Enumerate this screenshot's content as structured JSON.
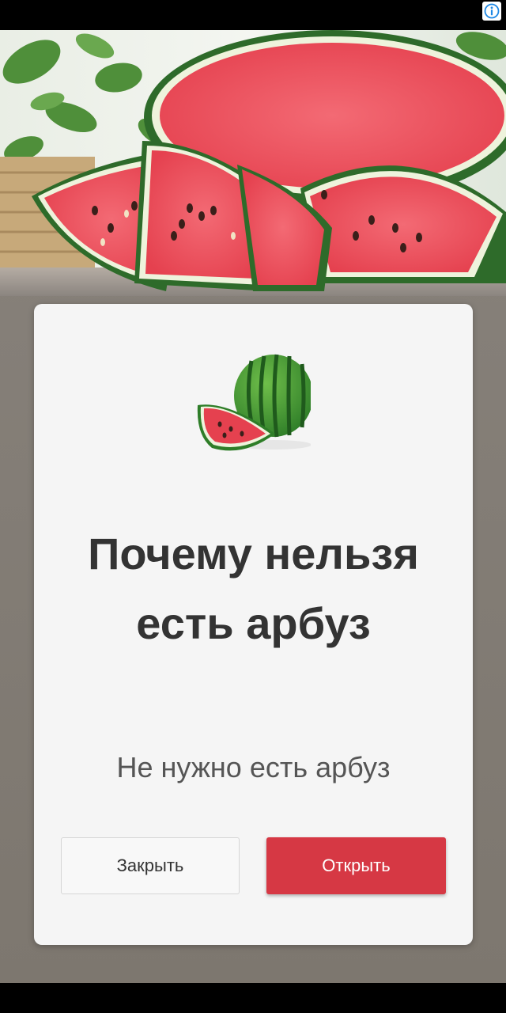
{
  "ad": {
    "title": "Почему нельзя есть арбуз",
    "subtitle": "Не нужно есть арбуз",
    "close_label": "Закрыть",
    "open_label": "Открыть"
  },
  "icons": {
    "info": "info-icon",
    "hero": "watermelon-photo",
    "card": "watermelon-icon"
  },
  "colors": {
    "open_button": "#d63844",
    "card_background": "#f5f5f5",
    "title_text": "#333333"
  }
}
